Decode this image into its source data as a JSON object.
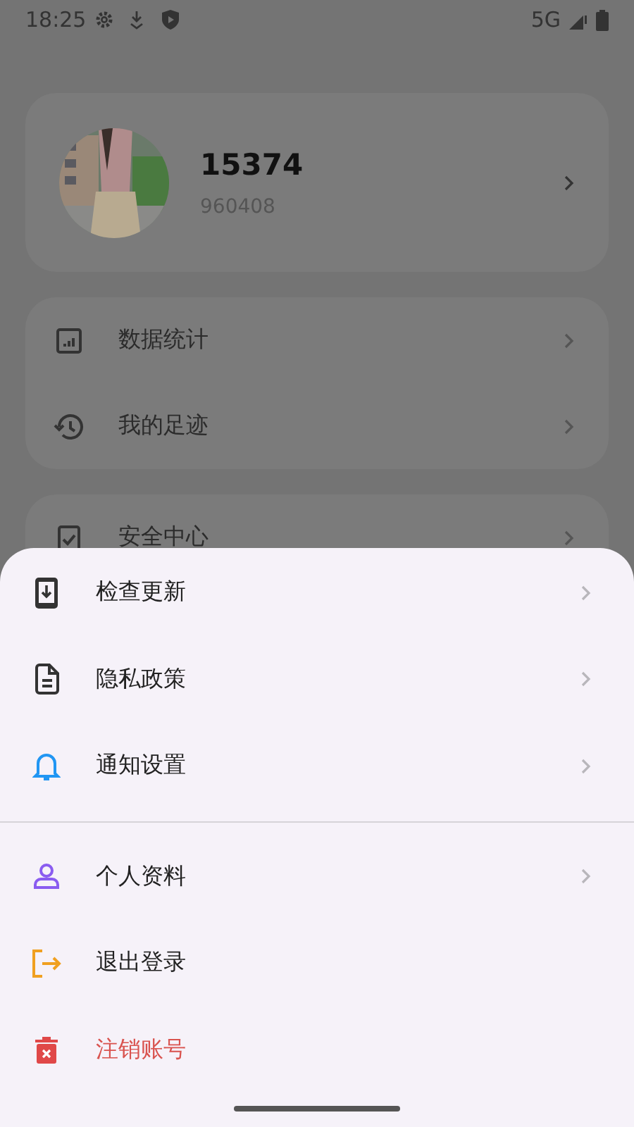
{
  "status_bar": {
    "time": "18:25",
    "network": "5G"
  },
  "profile": {
    "name": "15374",
    "id": "960408"
  },
  "menu_groups": [
    [
      {
        "label": "数据统计"
      },
      {
        "label": "我的足迹"
      }
    ],
    [
      {
        "label": "安全中心"
      }
    ]
  ],
  "sheet": {
    "groups": [
      [
        {
          "label": "检查更新",
          "chevron": true,
          "kind": "normal"
        },
        {
          "label": "隐私政策",
          "chevron": true,
          "kind": "normal"
        },
        {
          "label": "通知设置",
          "chevron": true,
          "kind": "normal"
        }
      ],
      [
        {
          "label": "个人资料",
          "chevron": true,
          "kind": "normal"
        },
        {
          "label": "退出登录",
          "chevron": false,
          "kind": "normal"
        },
        {
          "label": "注销账号",
          "chevron": false,
          "kind": "danger"
        }
      ]
    ]
  }
}
